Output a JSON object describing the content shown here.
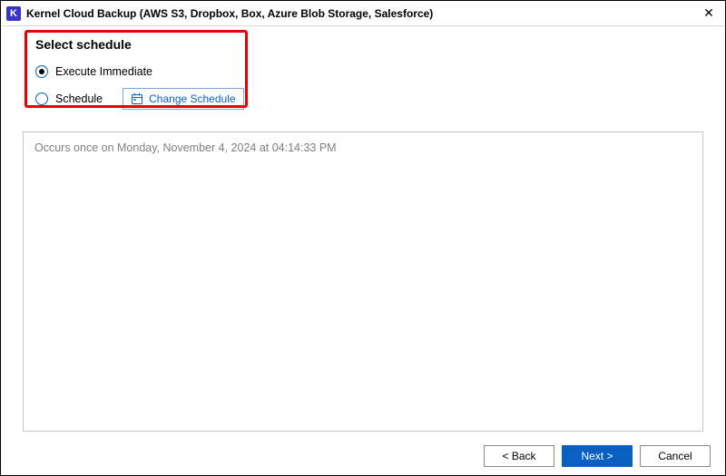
{
  "titlebar": {
    "app_icon_letter": "K",
    "title": "Kernel Cloud Backup (AWS S3, Dropbox, Box, Azure Blob Storage, Salesforce)",
    "close_glyph": "✕"
  },
  "schedule": {
    "heading": "Select schedule",
    "options": {
      "immediate": {
        "label": "Execute Immediate",
        "selected": true
      },
      "scheduled": {
        "label": "Schedule",
        "selected": false
      }
    },
    "change_button_label": "Change Schedule",
    "description": "Occurs once on Monday, November 4, 2024 at 04:14:33 PM"
  },
  "footer": {
    "back_label": "< Back",
    "next_label": "Next >",
    "cancel_label": "Cancel"
  }
}
